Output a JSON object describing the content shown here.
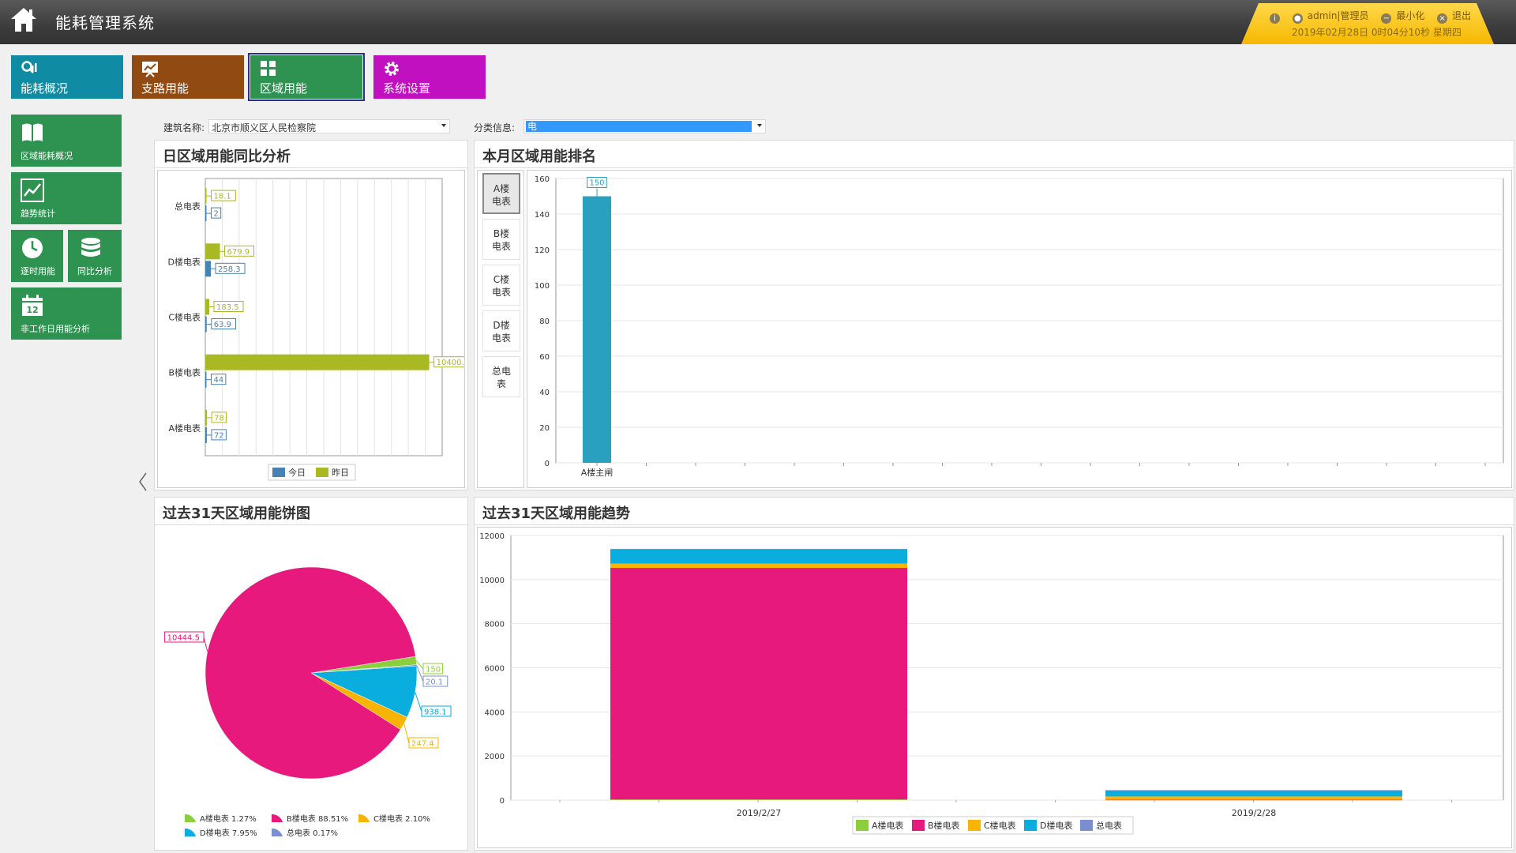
{
  "header": {
    "app_title": "能耗管理系统",
    "user": "admin|管理员",
    "minimize": "最小化",
    "logout": "退出",
    "datetime": "2019年02月28日  0时04分10秒  星期四"
  },
  "nav": {
    "overview": "能耗概况",
    "branch": "支路用能",
    "area": "区域用能",
    "settings": "系统设置"
  },
  "sidebar": {
    "area_overview": "区域能耗概况",
    "trend": "趋势统计",
    "hourly": "逐时用能",
    "yoy": "同比分析",
    "nonworkday": "非工作日用能分析",
    "calendar_day": "12"
  },
  "filters": {
    "building_label": "建筑名称:",
    "building_value": "北京市顺义区人民检察院",
    "category_label": "分类信息:",
    "category_value": "电"
  },
  "panels": {
    "daily_title": "日区域用能同比分析",
    "monthly_title": "本月区域用能排名",
    "pie_title": "过去31天区域用能饼图",
    "trend_title": "过去31天区域用能趋势"
  },
  "meter_tabs": [
    {
      "line1": "A楼",
      "line2": "电表"
    },
    {
      "line1": "B楼",
      "line2": "电表"
    },
    {
      "line1": "C楼",
      "line2": "电表"
    },
    {
      "line1": "D楼",
      "line2": "电表"
    },
    {
      "line1": "总电",
      "line2": "表"
    }
  ],
  "chart_data": [
    {
      "type": "bar",
      "orientation": "horizontal",
      "categories": [
        "总电表",
        "D楼电表",
        "C楼电表",
        "B楼电表",
        "A楼电表"
      ],
      "series": [
        {
          "name": "今日",
          "color": "#4682b4",
          "values": [
            2,
            258.3,
            63.9,
            44,
            72
          ]
        },
        {
          "name": "昨日",
          "color": "#a9b923",
          "values": [
            18.1,
            679.9,
            183.5,
            10400.5,
            78
          ]
        }
      ],
      "legend": "bottom"
    },
    {
      "type": "bar",
      "categories": [
        "A楼主闸"
      ],
      "values": [
        150
      ],
      "color": "#2aa0c0",
      "ylim": [
        0,
        160
      ],
      "yticks": [
        0,
        20,
        40,
        60,
        80,
        100,
        120,
        140,
        160
      ]
    },
    {
      "type": "pie",
      "slices": [
        {
          "name": "A楼电表",
          "value": 150,
          "percent": "1.27%",
          "color": "#8ccf3c"
        },
        {
          "name": "B楼电表",
          "value": 10444.5,
          "percent": "88.51%",
          "color": "#e8197c"
        },
        {
          "name": "C楼电表",
          "value": 247.4,
          "percent": "2.10%",
          "color": "#f8b400"
        },
        {
          "name": "D楼电表",
          "value": 938.1,
          "percent": "7.95%",
          "color": "#0aaede"
        },
        {
          "name": "总电表",
          "value": 20.1,
          "percent": "0.17%",
          "color": "#7b8fd0"
        }
      ],
      "legend": "bottom"
    },
    {
      "type": "bar",
      "stacked": true,
      "categories": [
        "2019/2/27",
        "2019/2/28"
      ],
      "series": [
        {
          "name": "A楼电表",
          "color": "#8ccf3c",
          "values": [
            30,
            10
          ]
        },
        {
          "name": "B楼电表",
          "color": "#e8197c",
          "values": [
            10500,
            5
          ]
        },
        {
          "name": "C楼电表",
          "color": "#f8b400",
          "values": [
            200,
            150
          ]
        },
        {
          "name": "D楼电表",
          "color": "#0aaede",
          "values": [
            650,
            280
          ]
        },
        {
          "name": "总电表",
          "color": "#7b8fd0",
          "values": [
            15,
            5
          ]
        }
      ],
      "ylim": [
        0,
        12000
      ],
      "yticks": [
        0,
        2000,
        4000,
        6000,
        8000,
        10000,
        12000
      ],
      "legend": "bottom"
    }
  ]
}
